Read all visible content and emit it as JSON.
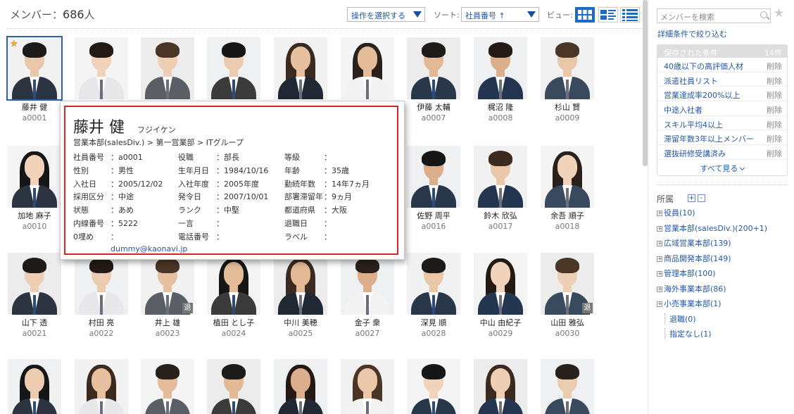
{
  "header": {
    "title_label": "メンバー：",
    "count": "686",
    "count_unit": "人",
    "action_select": "操作を選択する",
    "sort_label": "ソート:",
    "sort_select": "社員番号 ↑",
    "view_label": "ビュー:"
  },
  "members": [
    {
      "name": "藤井 健",
      "no": "a0001",
      "star": true,
      "retired": false
    },
    {
      "name": "",
      "no": "",
      "star": false,
      "retired": false
    },
    {
      "name": "",
      "no": "",
      "star": false,
      "retired": false
    },
    {
      "name": "",
      "no": "",
      "star": false,
      "retired": false
    },
    {
      "name": "",
      "no": "",
      "star": false,
      "retired": false
    },
    {
      "name": "",
      "no": "",
      "star": false,
      "retired": false
    },
    {
      "name": "伊藤 太輔",
      "no": "a0007",
      "star": false,
      "retired": false
    },
    {
      "name": "梶沼 隆",
      "no": "a0008",
      "star": false,
      "retired": false
    },
    {
      "name": "杉山 賢",
      "no": "a0009",
      "star": false,
      "retired": false
    },
    {
      "name": "加地 麻子",
      "no": "a0010",
      "star": false,
      "retired": false
    },
    {
      "name": "",
      "no": "",
      "star": false,
      "retired": false
    },
    {
      "name": "",
      "no": "",
      "star": false,
      "retired": false
    },
    {
      "name": "",
      "no": "",
      "star": false,
      "retired": false
    },
    {
      "name": "",
      "no": "",
      "star": false,
      "retired": false
    },
    {
      "name": "",
      "no": "",
      "star": false,
      "retired": false
    },
    {
      "name": "佐野 周平",
      "no": "a0016",
      "star": false,
      "retired": false
    },
    {
      "name": "鈴木 欣弘",
      "no": "a0017",
      "star": false,
      "retired": false
    },
    {
      "name": "余吾 順子",
      "no": "a0018",
      "star": false,
      "retired": false
    },
    {
      "name": "山下 透",
      "no": "a0021",
      "star": false,
      "retired": false
    },
    {
      "name": "村田 亮",
      "no": "a0022",
      "star": false,
      "retired": false
    },
    {
      "name": "井上 雄",
      "no": "a0023",
      "star": false,
      "retired": true
    },
    {
      "name": "植田 とし子",
      "no": "a0024",
      "star": false,
      "retired": false
    },
    {
      "name": "中川 美穂",
      "no": "a0025",
      "star": false,
      "retired": false
    },
    {
      "name": "金子 衆",
      "no": "a0027",
      "star": false,
      "retired": false
    },
    {
      "name": "深見 順",
      "no": "a0028",
      "star": false,
      "retired": false
    },
    {
      "name": "中山 由紀子",
      "no": "a0029",
      "star": false,
      "retired": false
    },
    {
      "name": "山田 雅弘",
      "no": "a0030",
      "star": false,
      "retired": true
    },
    {
      "name": "",
      "no": "",
      "star": false,
      "retired": false
    },
    {
      "name": "",
      "no": "",
      "star": false,
      "retired": false
    },
    {
      "name": "",
      "no": "",
      "star": false,
      "retired": false
    },
    {
      "name": "",
      "no": "",
      "star": false,
      "retired": false
    },
    {
      "name": "",
      "no": "",
      "star": false,
      "retired": false
    },
    {
      "name": "",
      "no": "",
      "star": false,
      "retired": false
    },
    {
      "name": "",
      "no": "",
      "star": false,
      "retired": false
    },
    {
      "name": "",
      "no": "",
      "star": false,
      "retired": false
    },
    {
      "name": "",
      "no": "",
      "star": false,
      "retired": false
    }
  ],
  "retired_badge": "退",
  "popup": {
    "name": "藤井 健",
    "kana": "フジイケン",
    "dept": "営業本部(salesDiv.) > 第一営業部 > ITグループ",
    "fields": [
      [
        {
          "k": "社員番号",
          "v": "a0001"
        },
        {
          "k": "役職",
          "v": "部長"
        },
        {
          "k": "等級",
          "v": ""
        }
      ],
      [
        {
          "k": "性別",
          "v": "男性"
        },
        {
          "k": "生年月日",
          "v": "1984/10/16"
        },
        {
          "k": "年齢",
          "v": "35歳"
        }
      ],
      [
        {
          "k": "入社日",
          "v": "2005/12/02"
        },
        {
          "k": "入社年度",
          "v": "2005年度"
        },
        {
          "k": "勤続年数",
          "v": "14年7ヵ月"
        }
      ],
      [
        {
          "k": "採用区分",
          "v": "中途"
        },
        {
          "k": "発令日",
          "v": "2007/10/01"
        },
        {
          "k": "部署滞留年",
          "v": "9ヵ月"
        }
      ],
      [
        {
          "k": "状態",
          "v": "あめ"
        },
        {
          "k": "ランク",
          "v": "中堅"
        },
        {
          "k": "都道府県",
          "v": "大阪"
        }
      ],
      [
        {
          "k": "内線番号",
          "v": "5222"
        },
        {
          "k": "一言",
          "v": ""
        },
        {
          "k": "退職日",
          "v": ""
        }
      ],
      [
        {
          "k": "0埋め",
          "v": "dummy@kaonavi.jp"
        },
        {
          "k": "電話番号",
          "v": ""
        },
        {
          "k": "ラベル",
          "v": ""
        }
      ]
    ]
  },
  "sidebar": {
    "search_placeholder": "メンバーを検索",
    "refine_link": "詳細条件で絞り込む",
    "saved_header": "保存された条件",
    "saved_count": "14件",
    "delete_label": "削除",
    "saved": [
      "40歳以下の高評価人材",
      "派遣社員リスト",
      "営業達成率200%以上",
      "中途入社者",
      "スキル平均4以上",
      "滞留年数3年以上メンバー",
      "選抜研修受講済み"
    ],
    "see_all": "すべて見る",
    "org_header": "所属",
    "org_expand": "+",
    "org_collapse": "-",
    "org": [
      {
        "label": "役員(10)",
        "box": "+"
      },
      {
        "label": "営業本部(salesDiv.)(200+1)",
        "box": "+"
      },
      {
        "label": "広域営業本部(139)",
        "box": "+"
      },
      {
        "label": "商品開発本部(149)",
        "box": "+"
      },
      {
        "label": "管理本部(100)",
        "box": "+"
      },
      {
        "label": "海外事業本部(86)",
        "box": "+"
      },
      {
        "label": "小売事業本部(1)",
        "box": "+"
      },
      {
        "label": "退職(0)",
        "box": ""
      },
      {
        "label": "指定なし(1)",
        "box": ""
      }
    ]
  },
  "colors": {
    "accent": "#1b6bc9",
    "link": "#2457a6",
    "popup_border": "#dd2222",
    "star": "#f2b01e"
  }
}
